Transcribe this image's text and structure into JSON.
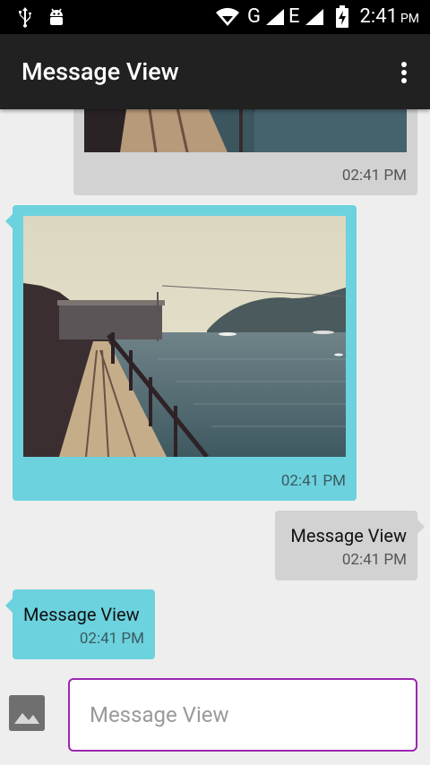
{
  "status_bar": {
    "network_1": "G",
    "network_2": "E",
    "time": "2:41",
    "ampm": "PM"
  },
  "toolbar": {
    "title": "Message View",
    "overflow_icon": "more-vert-icon"
  },
  "messages": [
    {
      "side": "sent",
      "type": "image",
      "time": "02:41 PM"
    },
    {
      "side": "received",
      "type": "image",
      "time": "02:41 PM"
    },
    {
      "side": "sent",
      "type": "text",
      "text": "Message View",
      "time": "02:41 PM"
    },
    {
      "side": "received",
      "type": "text",
      "text": "Message View",
      "time": "02:41 PM"
    }
  ],
  "composer": {
    "placeholder": "Message View",
    "image_icon": "image-icon"
  },
  "colors": {
    "sent_bubble": "#d2d2d2",
    "received_bubble": "#6cd2de",
    "toolbar": "#212121",
    "input_border": "#9c27b0"
  }
}
